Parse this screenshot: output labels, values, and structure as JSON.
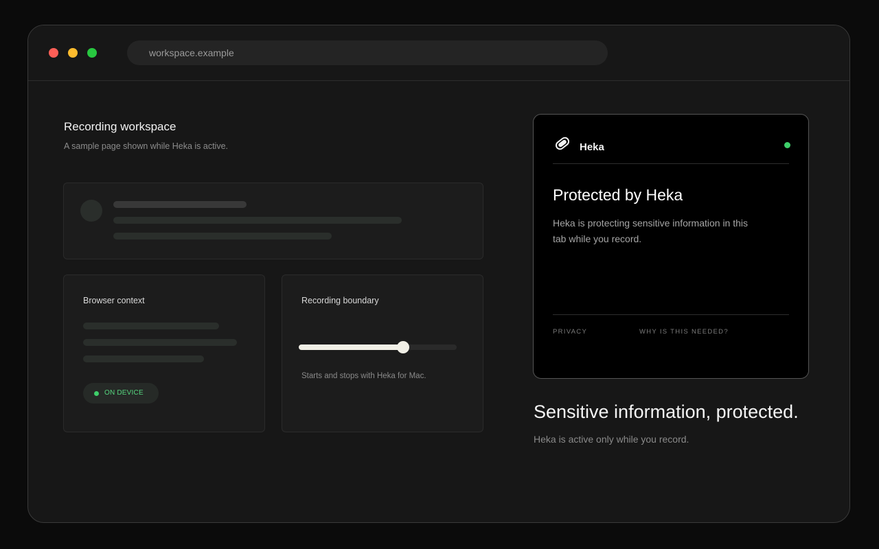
{
  "browser": {
    "url": "workspace.example",
    "colors": {
      "close": "#fe5f57",
      "minimize": "#febc2e",
      "maximize": "#28c840"
    }
  },
  "workspace": {
    "title": "Recording workspace",
    "subtitle": "A sample page shown while Heka is active."
  },
  "context_card": {
    "title": "Browser context",
    "badge": "ON DEVICE"
  },
  "boundary_card": {
    "title": "Recording boundary",
    "slider_value": 0.66,
    "caption": "Starts and stops with Heka for Mac."
  },
  "heka_panel": {
    "brand": "Heka",
    "status_color": "#3ecf6a",
    "heading": "Protected by Heka",
    "description": "Heka is protecting sensitive information in this tab while you record.",
    "links": [
      "PRIVACY",
      "WHY IS THIS NEEDED?"
    ],
    "logo_icon": "heka-logo-icon"
  },
  "hero": {
    "headline": "Sensitive information, protected.",
    "subline": "Heka is active only while you record."
  }
}
